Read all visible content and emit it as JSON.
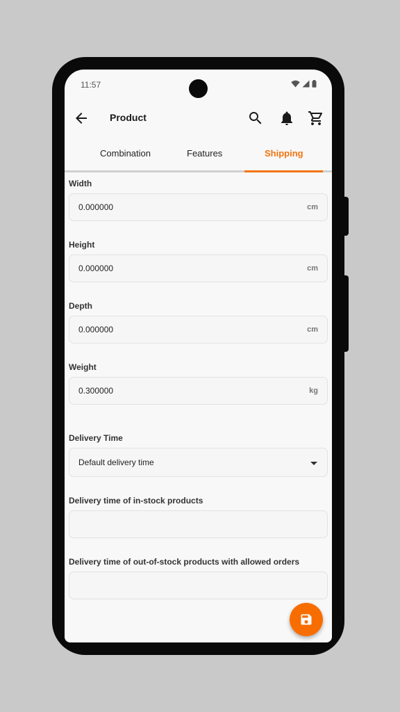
{
  "status_bar": {
    "time": "11:57"
  },
  "app_bar": {
    "title": "Product"
  },
  "tabs": [
    {
      "label": "Combination",
      "active": false
    },
    {
      "label": "Features",
      "active": false
    },
    {
      "label": "Shipping",
      "active": true
    }
  ],
  "accent_color": "#f27410",
  "form": {
    "width": {
      "label": "Width",
      "value": "0.000000",
      "unit": "cm"
    },
    "height": {
      "label": "Height",
      "value": "0.000000",
      "unit": "cm"
    },
    "depth": {
      "label": "Depth",
      "value": "0.000000",
      "unit": "cm"
    },
    "weight": {
      "label": "Weight",
      "value": "0.300000",
      "unit": "kg"
    },
    "delivery_time": {
      "label": "Delivery Time",
      "selected": "Default delivery time"
    },
    "in_stock_delivery": {
      "label": "Delivery time of in-stock products",
      "value": ""
    },
    "out_of_stock_delivery": {
      "label": "Delivery time of out-of-stock products with allowed orders",
      "value": ""
    }
  },
  "icons": {
    "back": "arrow-back-icon",
    "search": "search-icon",
    "notifications": "bell-icon",
    "cart": "cart-icon",
    "save": "save-icon"
  }
}
